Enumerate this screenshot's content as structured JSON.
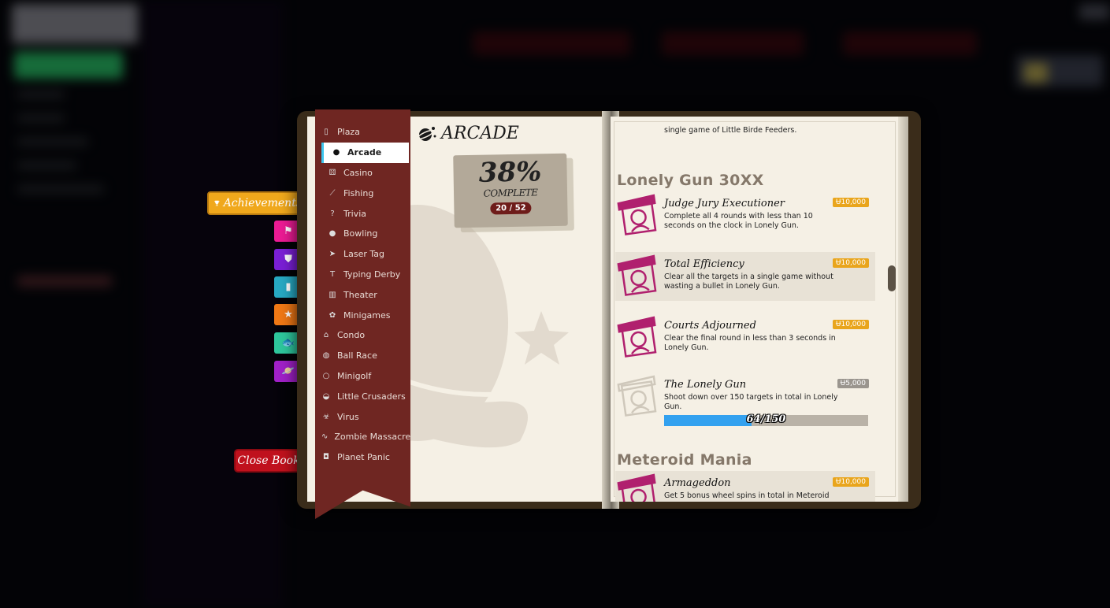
{
  "side_tabs": {
    "achievements_label": "Achievements",
    "icons": [
      {
        "name": "flag-icon",
        "color": "#ec1b94",
        "glyph": "⚑"
      },
      {
        "name": "shield-icon",
        "color": "#7a1fd6",
        "glyph": "⛊"
      },
      {
        "name": "bar-chart-icon",
        "color": "#27a9c3",
        "glyph": "▮"
      },
      {
        "name": "podium-icon",
        "color": "#f07815",
        "glyph": "★"
      },
      {
        "name": "fish-icon",
        "color": "#2ec79d",
        "glyph": "🐟"
      },
      {
        "name": "planet-icon",
        "color": "#a020c8",
        "glyph": "🪐"
      }
    ],
    "close_label": "Close Book"
  },
  "nav": {
    "items": [
      {
        "label": "Plaza",
        "level": "top-sub",
        "icon": "plaza-icon",
        "glyph": "▯"
      },
      {
        "label": "Arcade",
        "level": "sub",
        "icon": "arcade-icon",
        "glyph": "●",
        "active": true
      },
      {
        "label": "Casino",
        "level": "sub",
        "icon": "casino-icon",
        "glyph": "⚄"
      },
      {
        "label": "Fishing",
        "level": "sub",
        "icon": "fishing-icon",
        "glyph": "⟋"
      },
      {
        "label": "Trivia",
        "level": "sub",
        "icon": "trivia-icon",
        "glyph": "?"
      },
      {
        "label": "Bowling",
        "level": "sub",
        "icon": "bowling-icon",
        "glyph": "●"
      },
      {
        "label": "Laser Tag",
        "level": "sub",
        "icon": "laser-tag-icon",
        "glyph": "➤"
      },
      {
        "label": "Typing Derby",
        "level": "sub",
        "icon": "typing-derby-icon",
        "glyph": "T"
      },
      {
        "label": "Theater",
        "level": "sub",
        "icon": "theater-icon",
        "glyph": "▥"
      },
      {
        "label": "Minigames",
        "level": "sub",
        "icon": "minigames-icon",
        "glyph": "✿"
      },
      {
        "label": "Condo",
        "level": "top",
        "icon": "condo-icon",
        "glyph": "⌂"
      },
      {
        "label": "Ball Race",
        "level": "top",
        "icon": "ball-race-icon",
        "glyph": "◍"
      },
      {
        "label": "Minigolf",
        "level": "top",
        "icon": "minigolf-icon",
        "glyph": "○"
      },
      {
        "label": "Little Crusaders",
        "level": "top",
        "icon": "little-crusaders-icon",
        "glyph": "◒"
      },
      {
        "label": "Virus",
        "level": "top",
        "icon": "virus-icon",
        "glyph": "☣"
      },
      {
        "label": "Zombie Massacre",
        "level": "top",
        "icon": "zombie-massacre-icon",
        "glyph": "∿"
      },
      {
        "label": "Planet Panic",
        "level": "top",
        "icon": "planet-panic-icon",
        "glyph": "◘"
      }
    ]
  },
  "left_page": {
    "title": "ARCADE",
    "percent": "38%",
    "complete_label": "COMPLETE",
    "count_badge": "20 / 52"
  },
  "right_page": {
    "partial_top_desc": "single game of Little Birde Feeders.",
    "sections": [
      {
        "title": "Lonely Gun 30XX",
        "achievements": [
          {
            "name": "Judge Jury Executioner",
            "desc": "Complete all 4 rounds with less than 10 seconds on the clock in Lonely Gun.",
            "reward": "Ʉ10,000",
            "completed": true,
            "highlight": false
          },
          {
            "name": "Total Efficiency",
            "desc": "Clear all the targets in a single game without wasting a bullet in Lonely Gun.",
            "reward": "Ʉ10,000",
            "completed": true,
            "highlight": true
          },
          {
            "name": "Courts Adjourned",
            "desc": "Clear the final round in less than 3 seconds in Lonely Gun.",
            "reward": "Ʉ10,000",
            "completed": true,
            "highlight": false
          },
          {
            "name": "The Lonely Gun",
            "desc": "Shoot down over 150 targets in total in Lonely Gun.",
            "reward": "Ʉ5,000",
            "completed": false,
            "highlight": false,
            "progress": {
              "current": 64,
              "total": 150,
              "label": "64/150"
            }
          }
        ]
      },
      {
        "title": "Meteroid Mania",
        "achievements": [
          {
            "name": "Armageddon",
            "desc": "Get 5 bonus wheel spins in total in Meteroid",
            "reward": "Ʉ10,000",
            "completed": true,
            "highlight": true
          }
        ]
      }
    ],
    "stamp_label": "ARCADE"
  },
  "colors": {
    "ribbon": "#6f2622",
    "reward_gold": "#e9a51c",
    "reward_grey": "#9a958e",
    "progress_fill": "#33a1ef",
    "stamp": "#b0206e",
    "active_indicator": "#3cc6ef"
  }
}
